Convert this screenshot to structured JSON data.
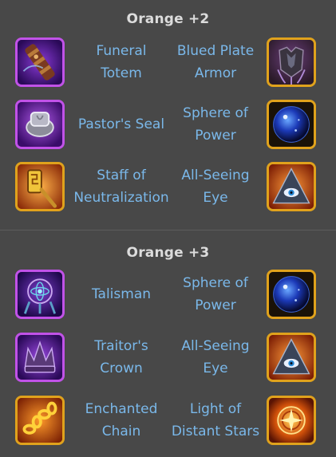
{
  "sections": [
    {
      "title": "Orange +2",
      "rows": [
        {
          "left": {
            "name": "Funeral\nTotem",
            "icon": "funeral-totem-icon",
            "frame": "purple"
          },
          "right": {
            "name": "Blued Plate\nArmor",
            "icon": "blued-plate-armor-icon",
            "frame": "gold"
          }
        },
        {
          "left": {
            "name": "Pastor's Seal",
            "icon": "pastors-seal-icon",
            "frame": "purple"
          },
          "right": {
            "name": "Sphere of\nPower",
            "icon": "sphere-of-power-icon",
            "frame": "gold"
          }
        },
        {
          "left": {
            "name": "Staff of\nNeutralization",
            "icon": "staff-of-neutralization-icon",
            "frame": "gold"
          },
          "right": {
            "name": "All-Seeing\nEye",
            "icon": "all-seeing-eye-icon",
            "frame": "gold"
          }
        }
      ]
    },
    {
      "title": "Orange +3",
      "rows": [
        {
          "left": {
            "name": "Talisman",
            "icon": "talisman-icon",
            "frame": "purple"
          },
          "right": {
            "name": "Sphere of\nPower",
            "icon": "sphere-of-power-icon",
            "frame": "gold"
          }
        },
        {
          "left": {
            "name": "Traitor's\nCrown",
            "icon": "traitors-crown-icon",
            "frame": "purple"
          },
          "right": {
            "name": "All-Seeing\nEye",
            "icon": "all-seeing-eye-icon",
            "frame": "gold"
          }
        },
        {
          "left": {
            "name": "Enchanted\nChain",
            "icon": "enchanted-chain-icon",
            "frame": "gold"
          },
          "right": {
            "name": "Light of\nDistant Stars",
            "icon": "light-of-distant-stars-icon",
            "frame": "gold"
          }
        }
      ]
    }
  ],
  "colors": {
    "background": "#484848",
    "title": "#dcdcdc",
    "item_name": "#7ab8ea",
    "frame_purple": "#c152e8",
    "frame_gold": "#e0a21c"
  }
}
